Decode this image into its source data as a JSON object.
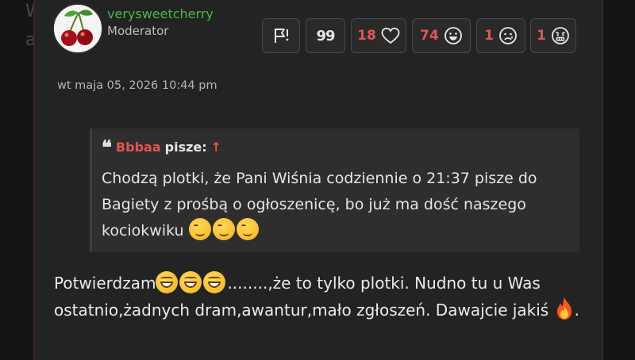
{
  "background": {
    "fragment_top": "W",
    "fragment_bottom": "a"
  },
  "post": {
    "author": {
      "username": "verysweetcherry",
      "role": "Moderator",
      "avatar_icon": "cherry-icon"
    },
    "actions": [
      {
        "name": "report-button",
        "icon": "flag-icon"
      },
      {
        "name": "quote-button",
        "icon": "quote-icon",
        "label": "99"
      },
      {
        "name": "reaction-heart-button",
        "icon": "heart-icon",
        "count": "18"
      },
      {
        "name": "reaction-smile-button",
        "icon": "smile-icon",
        "count": "74"
      },
      {
        "name": "reaction-sad-button",
        "icon": "sad-face-icon",
        "count": "1"
      },
      {
        "name": "reaction-angry-button",
        "icon": "angry-face-icon",
        "count": "1"
      }
    ],
    "date": "wt maja 05, 2026 10:44 pm",
    "quote": {
      "author": "Bbbaa",
      "says": "pisze:",
      "up_arrow": "↑",
      "text": "Chodzą plotki, że Pani Wiśnia codziennie o 21:37 pisze do Bagiety z prośbą o ogłoszenicę, bo już ma dość naszego kociokwiku"
    },
    "body": {
      "part1": "Potwierdzam",
      "part2": "........,że to tylko plotki. Nudno tu u Was ostatnio,żadnych dram,awantur,mało zgłoszeń. Dawajcie jakiś",
      "part3": "."
    }
  },
  "colors": {
    "username": "#4bb84b",
    "count": "#e05555",
    "panel": "#232323",
    "quote_bg": "#2e2e2e"
  }
}
